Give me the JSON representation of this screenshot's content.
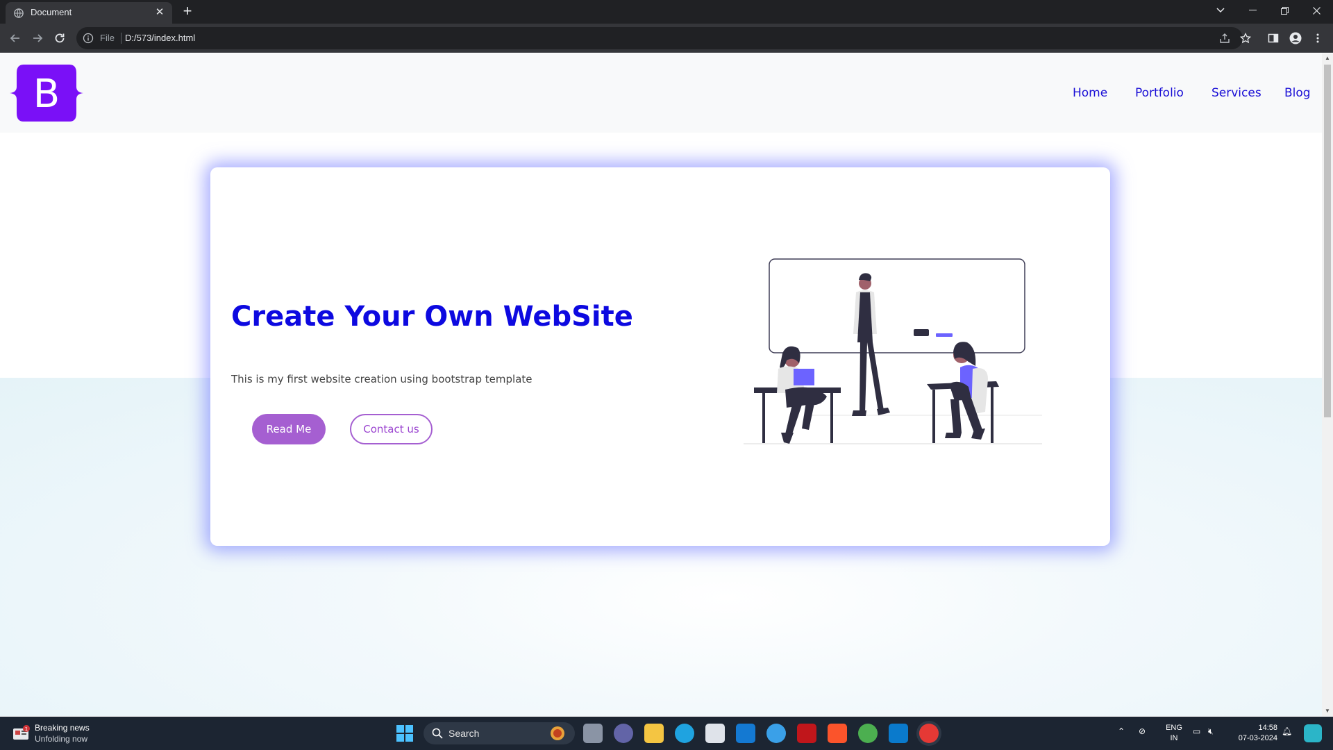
{
  "browser": {
    "tab_title": "Document",
    "url_scheme_label": "File",
    "url": "D:/573/index.html"
  },
  "page": {
    "nav": {
      "brand_letter": "B",
      "links": [
        "Home",
        "Portfolio",
        "Services",
        "Blog"
      ]
    },
    "hero": {
      "title": "Create Your Own WebSite",
      "text": "This is my first website creation using bootstrap template",
      "read_button": "Read Me",
      "contact_button": "Contact us"
    },
    "colors": {
      "link": "#1a0fd6",
      "title": "#0d09e0",
      "accent": "#a55fd1",
      "brand": "#7a10f7",
      "card_glow": "#6470ff"
    }
  },
  "taskbar": {
    "news_badge": "1",
    "news_title": "Breaking news",
    "news_subtitle": "Unfolding now",
    "search_label": "Search",
    "language": "ENG",
    "region": "IN",
    "time": "14:58",
    "date": "07-03-2024"
  }
}
